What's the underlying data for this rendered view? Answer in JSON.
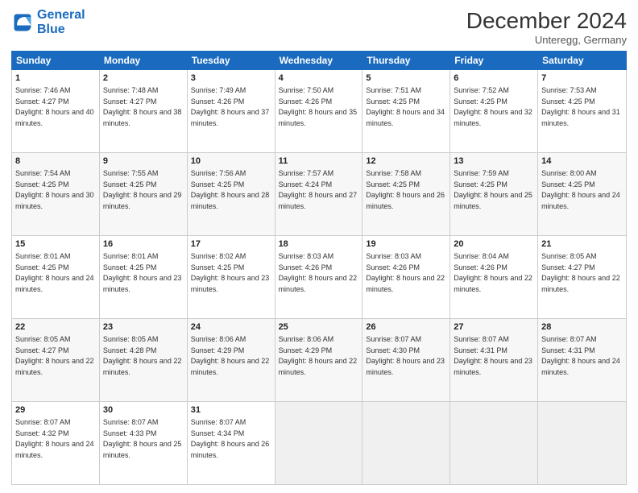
{
  "logo": {
    "line1": "General",
    "line2": "Blue"
  },
  "title": "December 2024",
  "subtitle": "Unteregg, Germany",
  "header_days": [
    "Sunday",
    "Monday",
    "Tuesday",
    "Wednesday",
    "Thursday",
    "Friday",
    "Saturday"
  ],
  "weeks": [
    [
      {
        "day": "1",
        "sunrise": "7:46 AM",
        "sunset": "4:27 PM",
        "daylight": "8 hours and 40 minutes."
      },
      {
        "day": "2",
        "sunrise": "7:48 AM",
        "sunset": "4:27 PM",
        "daylight": "8 hours and 38 minutes."
      },
      {
        "day": "3",
        "sunrise": "7:49 AM",
        "sunset": "4:26 PM",
        "daylight": "8 hours and 37 minutes."
      },
      {
        "day": "4",
        "sunrise": "7:50 AM",
        "sunset": "4:26 PM",
        "daylight": "8 hours and 35 minutes."
      },
      {
        "day": "5",
        "sunrise": "7:51 AM",
        "sunset": "4:25 PM",
        "daylight": "8 hours and 34 minutes."
      },
      {
        "day": "6",
        "sunrise": "7:52 AM",
        "sunset": "4:25 PM",
        "daylight": "8 hours and 32 minutes."
      },
      {
        "day": "7",
        "sunrise": "7:53 AM",
        "sunset": "4:25 PM",
        "daylight": "8 hours and 31 minutes."
      }
    ],
    [
      {
        "day": "8",
        "sunrise": "7:54 AM",
        "sunset": "4:25 PM",
        "daylight": "8 hours and 30 minutes."
      },
      {
        "day": "9",
        "sunrise": "7:55 AM",
        "sunset": "4:25 PM",
        "daylight": "8 hours and 29 minutes."
      },
      {
        "day": "10",
        "sunrise": "7:56 AM",
        "sunset": "4:25 PM",
        "daylight": "8 hours and 28 minutes."
      },
      {
        "day": "11",
        "sunrise": "7:57 AM",
        "sunset": "4:24 PM",
        "daylight": "8 hours and 27 minutes."
      },
      {
        "day": "12",
        "sunrise": "7:58 AM",
        "sunset": "4:25 PM",
        "daylight": "8 hours and 26 minutes."
      },
      {
        "day": "13",
        "sunrise": "7:59 AM",
        "sunset": "4:25 PM",
        "daylight": "8 hours and 25 minutes."
      },
      {
        "day": "14",
        "sunrise": "8:00 AM",
        "sunset": "4:25 PM",
        "daylight": "8 hours and 24 minutes."
      }
    ],
    [
      {
        "day": "15",
        "sunrise": "8:01 AM",
        "sunset": "4:25 PM",
        "daylight": "8 hours and 24 minutes."
      },
      {
        "day": "16",
        "sunrise": "8:01 AM",
        "sunset": "4:25 PM",
        "daylight": "8 hours and 23 minutes."
      },
      {
        "day": "17",
        "sunrise": "8:02 AM",
        "sunset": "4:25 PM",
        "daylight": "8 hours and 23 minutes."
      },
      {
        "day": "18",
        "sunrise": "8:03 AM",
        "sunset": "4:26 PM",
        "daylight": "8 hours and 22 minutes."
      },
      {
        "day": "19",
        "sunrise": "8:03 AM",
        "sunset": "4:26 PM",
        "daylight": "8 hours and 22 minutes."
      },
      {
        "day": "20",
        "sunrise": "8:04 AM",
        "sunset": "4:26 PM",
        "daylight": "8 hours and 22 minutes."
      },
      {
        "day": "21",
        "sunrise": "8:05 AM",
        "sunset": "4:27 PM",
        "daylight": "8 hours and 22 minutes."
      }
    ],
    [
      {
        "day": "22",
        "sunrise": "8:05 AM",
        "sunset": "4:27 PM",
        "daylight": "8 hours and 22 minutes."
      },
      {
        "day": "23",
        "sunrise": "8:05 AM",
        "sunset": "4:28 PM",
        "daylight": "8 hours and 22 minutes."
      },
      {
        "day": "24",
        "sunrise": "8:06 AM",
        "sunset": "4:29 PM",
        "daylight": "8 hours and 22 minutes."
      },
      {
        "day": "25",
        "sunrise": "8:06 AM",
        "sunset": "4:29 PM",
        "daylight": "8 hours and 22 minutes."
      },
      {
        "day": "26",
        "sunrise": "8:07 AM",
        "sunset": "4:30 PM",
        "daylight": "8 hours and 23 minutes."
      },
      {
        "day": "27",
        "sunrise": "8:07 AM",
        "sunset": "4:31 PM",
        "daylight": "8 hours and 23 minutes."
      },
      {
        "day": "28",
        "sunrise": "8:07 AM",
        "sunset": "4:31 PM",
        "daylight": "8 hours and 24 minutes."
      }
    ],
    [
      {
        "day": "29",
        "sunrise": "8:07 AM",
        "sunset": "4:32 PM",
        "daylight": "8 hours and 24 minutes."
      },
      {
        "day": "30",
        "sunrise": "8:07 AM",
        "sunset": "4:33 PM",
        "daylight": "8 hours and 25 minutes."
      },
      {
        "day": "31",
        "sunrise": "8:07 AM",
        "sunset": "4:34 PM",
        "daylight": "8 hours and 26 minutes."
      },
      null,
      null,
      null,
      null
    ]
  ]
}
